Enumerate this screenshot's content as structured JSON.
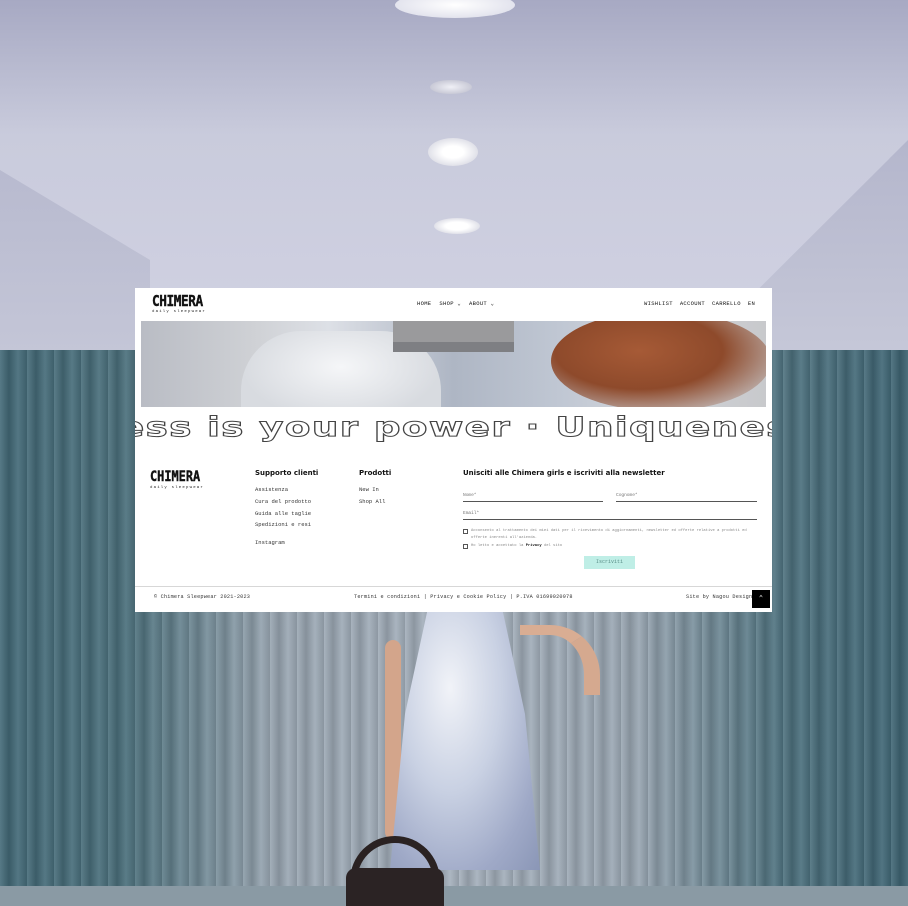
{
  "header": {
    "logo_word": "CHIMERA",
    "logo_tagline": "daily sleepwear",
    "nav": [
      "HOME",
      "SHOP ⌄",
      "ABOUT ⌄"
    ],
    "nav_right": [
      "WISHLIST",
      "ACCOUNT",
      "CARRELLO",
      "EN"
    ]
  },
  "marquee": {
    "text": "ess is your power · Uniqueness is yo"
  },
  "footer": {
    "logo_word": "CHIMERA",
    "logo_tagline": "daily sleepwear",
    "support": {
      "title": "Supporto clienti",
      "links": [
        "Assistenza",
        "Cura del prodotto",
        "Guida alle taglie",
        "Spedizioni e resi",
        "Instagram"
      ]
    },
    "products": {
      "title": "Prodotti",
      "links": [
        "New In",
        "Shop All"
      ]
    },
    "newsletter": {
      "title": "Unisciti alle Chimera girls e iscriviti alla newsletter",
      "name_placeholder": "Nome*",
      "surname_placeholder": "Cognome*",
      "email_placeholder": "Email*",
      "consent_marketing": "Acconsento al trattamento dei miei dati per il ricevimento di aggiornamenti, newsletter ed offerte relative a prodotti ed offerte inerenti all'azienda.",
      "consent_privacy_prefix": "Ho letto e accettato la",
      "consent_privacy_link": "Privacy",
      "consent_privacy_suffix": "del sito",
      "subscribe_label": "Iscriviti"
    }
  },
  "bottom_bar": {
    "copyright": "© Chimera Sleepwear 2021-2023",
    "legal": "Termini e condizioni | Privacy e Cookie Policy | P.IVA 01699020978",
    "credit": "Site by Nagou Design"
  },
  "colors": {
    "subscribe_bg": "#bfeee6",
    "text": "#111111"
  },
  "icons": {
    "scroll_top": "chevron-up-icon"
  }
}
